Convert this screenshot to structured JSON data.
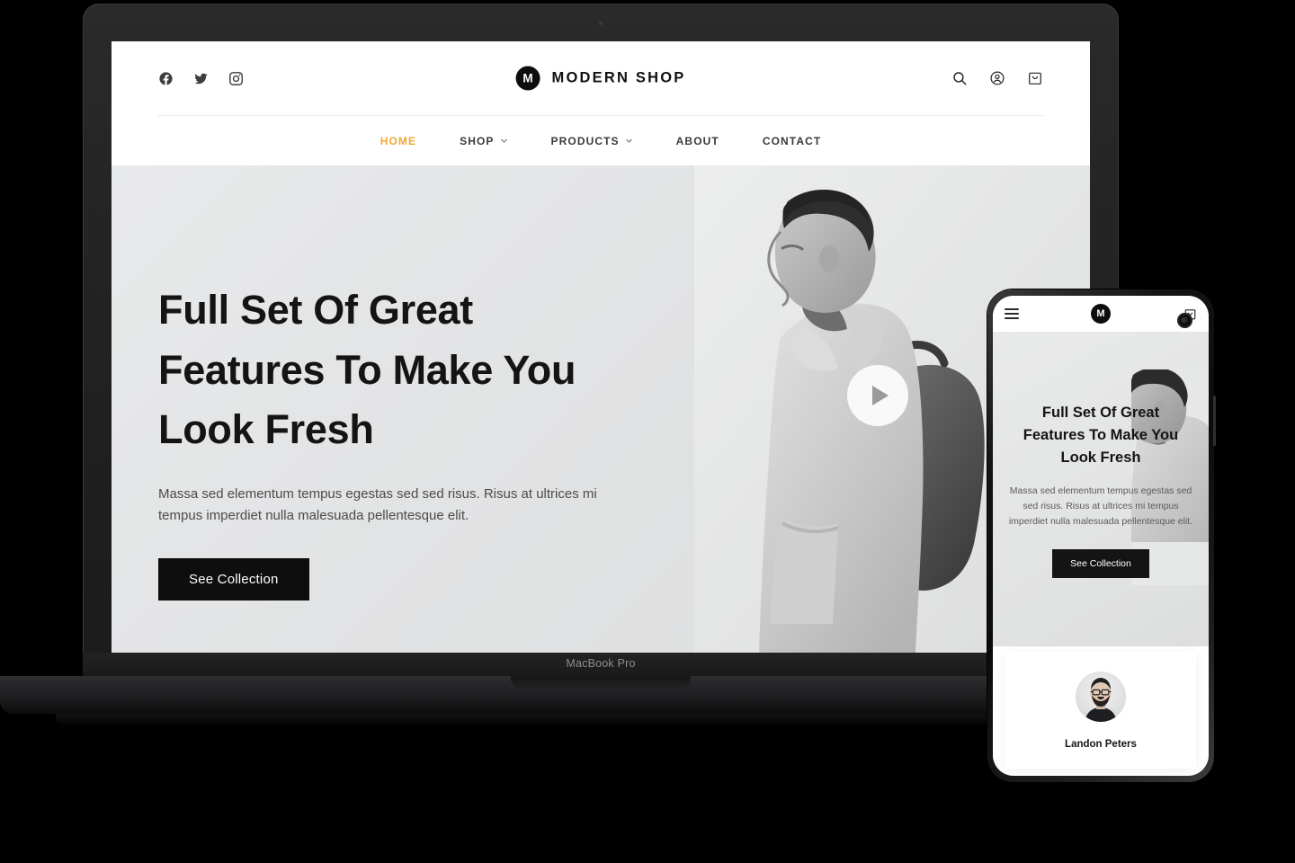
{
  "background_color": "#000000",
  "devices": {
    "laptop": {
      "model_label": "MacBook Pro"
    },
    "phone": {
      "model_label": ""
    }
  },
  "site": {
    "brand": {
      "mark": "M",
      "name": "MODERN SHOP"
    },
    "social": [
      {
        "name": "facebook",
        "icon": "facebook-icon"
      },
      {
        "name": "twitter",
        "icon": "twitter-icon"
      },
      {
        "name": "instagram",
        "icon": "instagram-icon"
      }
    ],
    "utility_icons": [
      {
        "name": "search",
        "icon": "search-icon"
      },
      {
        "name": "account",
        "icon": "account-icon"
      },
      {
        "name": "cart",
        "icon": "cart-icon"
      }
    ],
    "nav": [
      {
        "label": "HOME",
        "active": true,
        "has_dropdown": false
      },
      {
        "label": "SHOP",
        "active": false,
        "has_dropdown": true
      },
      {
        "label": "PRODUCTS",
        "active": false,
        "has_dropdown": true
      },
      {
        "label": "ABOUT",
        "active": false,
        "has_dropdown": false
      },
      {
        "label": "CONTACT",
        "active": false,
        "has_dropdown": false
      }
    ],
    "nav_active_color": "#f0a830",
    "hero": {
      "heading": "Full Set Of Great Features To Make You Look Fresh",
      "heading_line1": "Full Set Of Great",
      "heading_line2": "Features To Make You",
      "heading_line3": "Look Fresh",
      "paragraph": "Massa sed elementum tempus egestas sed sed risus. Risus at ultrices mi tempus imperdiet nulla malesuada pellentesque elit.",
      "cta_label": "See Collection",
      "play_button": "play-icon",
      "image_alt": "Man in profile wearing jacket with backpack, black and white"
    }
  },
  "mobile": {
    "logo_mark": "M",
    "menu_icon": "hamburger-menu-icon",
    "cart_icon": "cart-icon",
    "hero": {
      "heading_line1": "Full Set Of Great",
      "heading_line2": "Features To Make You",
      "heading_line3": "Look Fresh",
      "paragraph": "Massa sed elementum tempus egestas sed sed risus. Risus at ultrices mi tempus imperdiet nulla malesuada pellentesque elit.",
      "cta_label": "See Collection"
    },
    "testimonial": {
      "author_name": "Landon Peters",
      "avatar_alt": "Portrait of bearded man with glasses"
    }
  }
}
